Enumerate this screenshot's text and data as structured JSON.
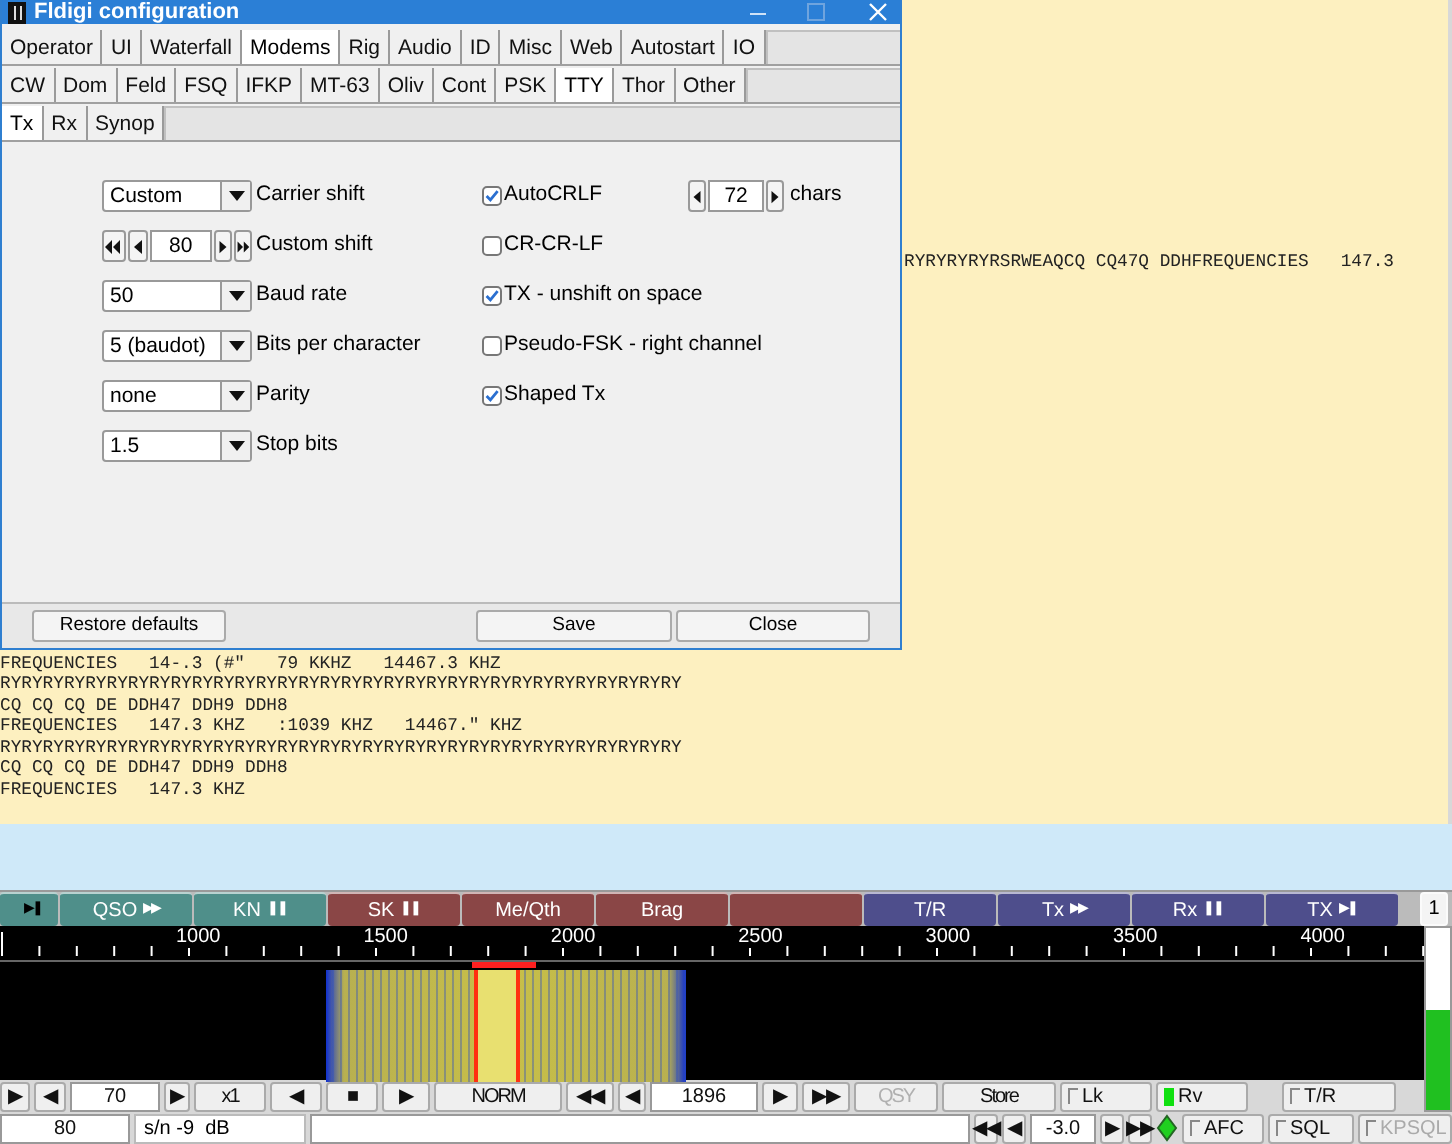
{
  "main": {
    "rx_side_line": "RYRYRYRYRSRWEAQCQ CQ47Q DDHFREQUENCIES   147.3",
    "rx_lines": [
      "FREQUENCIES   14-.3 (#\"   79 KKHZ   14467.3 KHZ",
      "RYRYRYRYRYRYRYRYRYRYRYRYRYRYRYRYRYRYRYRYRYRYRYRYRYRYRYRYRYRYRYRY",
      "CQ CQ CQ DE DDH47 DDH9 DDH8",
      "FREQUENCIES   147.3 KHZ   :1039 KHZ   14467.\" KHZ",
      "RYRYRYRYRYRYRYRYRYRYRYRYRYRYRYRYRYRYRYRYRYRYRYRYRYRYRYRYRYRYRYRY",
      "CQ CQ CQ DE DDH47 DDH9 DDH8",
      "FREQUENCIES   147.3 KHZ"
    ],
    "macros": [
      {
        "glyph": "▶❚",
        "color": "#4f8f8a"
      },
      {
        "label": "QSO",
        "glyph": "▶▶",
        "color": "#4f8f8a"
      },
      {
        "label": "KN",
        "glyph": "❚❚",
        "color": "#4f8f8a"
      },
      {
        "label": "SK",
        "glyph": "❚❚",
        "color": "#8a4646"
      },
      {
        "label": "Me/Qth",
        "color": "#8a4646"
      },
      {
        "label": "Brag",
        "color": "#8a4646"
      },
      {
        "color": "#8a4646"
      },
      {
        "label": "T/R",
        "color": "#4e4e8c"
      },
      {
        "label": "Tx",
        "glyph": "▶▶",
        "color": "#4e4e8c"
      },
      {
        "label": "Rx",
        "glyph": "❚❚",
        "color": "#4e4e8c"
      },
      {
        "label": "TX",
        "glyph": "▶❚",
        "color": "#4e4e8c"
      },
      {
        "label": "1",
        "color": "#f4f4f4"
      }
    ],
    "ruler": {
      "labels": [
        "1000",
        "1500",
        "2000",
        "2500",
        "3000",
        "3500",
        "4000"
      ]
    },
    "signal_level": {
      "level": 0.55
    },
    "controls": [
      {
        "kind": "button",
        "text": "▶"
      },
      {
        "kind": "button",
        "text": "◀"
      },
      {
        "kind": "field",
        "text": "70"
      },
      {
        "kind": "button",
        "text": "▶"
      },
      {
        "kind": "button",
        "text": "x1"
      },
      {
        "kind": "button",
        "text": "◀"
      },
      {
        "kind": "button",
        "text": "■"
      },
      {
        "kind": "button",
        "text": "▶"
      },
      {
        "kind": "button",
        "text": "NORM"
      },
      {
        "kind": "button",
        "text": "◀◀"
      },
      {
        "kind": "button",
        "text": "◀"
      },
      {
        "kind": "field",
        "text": "1896"
      },
      {
        "kind": "button",
        "text": "▶"
      },
      {
        "kind": "button",
        "text": "▶▶"
      },
      {
        "kind": "button",
        "text": "QSY",
        "disabled": true
      },
      {
        "kind": "button",
        "text": "Store"
      },
      {
        "kind": "check",
        "text": "Lk",
        "checked": false
      },
      {
        "kind": "light",
        "text": "Rv",
        "on": true
      },
      {
        "kind": "check",
        "text": "T/R",
        "checked": false
      }
    ],
    "status": [
      {
        "kind": "field",
        "text": "80"
      },
      {
        "kind": "label",
        "text": "s/n -9  dB"
      },
      {
        "kind": "field"
      },
      {
        "kind": "button",
        "text": "◀◀"
      },
      {
        "kind": "button",
        "text": "◀"
      },
      {
        "kind": "field",
        "text": "-3.0"
      },
      {
        "kind": "button",
        "text": "▶"
      },
      {
        "kind": "button",
        "text": "▶▶"
      },
      {
        "kind": "diamond",
        "on": true
      },
      {
        "kind": "check",
        "text": "AFC",
        "checked": false
      },
      {
        "kind": "check",
        "text": "SQL",
        "checked": false
      },
      {
        "kind": "check",
        "text": "KPSQL",
        "checked": false,
        "disabled": true
      }
    ]
  },
  "dialog": {
    "title": "Fldigi configuration",
    "tab_rows": [
      [
        {
          "label": "Operator",
          "selected": false
        },
        {
          "label": "UI",
          "selected": false
        },
        {
          "label": "Waterfall",
          "selected": false
        },
        {
          "label": "Modems",
          "selected": true
        },
        {
          "label": "Rig",
          "selected": false
        },
        {
          "label": "Audio",
          "selected": false
        },
        {
          "label": "ID",
          "selected": false
        },
        {
          "label": "Misc",
          "selected": false
        },
        {
          "label": "Web",
          "selected": false
        },
        {
          "label": "Autostart",
          "selected": false
        },
        {
          "label": "IO",
          "selected": false
        }
      ],
      [
        {
          "label": "CW",
          "selected": false
        },
        {
          "label": "Dom",
          "selected": false
        },
        {
          "label": "Feld",
          "selected": false
        },
        {
          "label": "FSQ",
          "selected": false
        },
        {
          "label": "IFKP",
          "selected": false
        },
        {
          "label": "MT-63",
          "selected": false
        },
        {
          "label": "Oliv",
          "selected": false
        },
        {
          "label": "Cont",
          "selected": false
        },
        {
          "label": "PSK",
          "selected": false
        },
        {
          "label": "TTY",
          "selected": true
        },
        {
          "label": "Thor",
          "selected": false
        },
        {
          "label": "Other",
          "selected": false
        }
      ],
      [
        {
          "label": "Tx",
          "selected": true
        },
        {
          "label": "Rx",
          "selected": false
        },
        {
          "label": "Synop",
          "selected": false
        }
      ]
    ],
    "left_settings": [
      {
        "kind": "dropdown",
        "value": "Custom",
        "label": "Carrier shift"
      },
      {
        "kind": "spinner",
        "value": "80",
        "label": "Custom shift"
      },
      {
        "kind": "dropdown",
        "value": "50",
        "label": "Baud rate"
      },
      {
        "kind": "dropdown",
        "value": "5 (baudot)",
        "label": "Bits per character"
      },
      {
        "kind": "dropdown",
        "value": "none",
        "label": "Parity"
      },
      {
        "kind": "dropdown",
        "value": "1.5",
        "label": "Stop bits"
      }
    ],
    "right_settings": [
      {
        "label": "AutoCRLF",
        "checked": true
      },
      {
        "label": "CR-CR-LF",
        "checked": false
      },
      {
        "label": "TX - unshift on space",
        "checked": true
      },
      {
        "label": "Pseudo-FSK - right channel",
        "checked": false
      },
      {
        "label": "Shaped Tx",
        "checked": true
      }
    ],
    "line_length": {
      "value": "72",
      "label": "chars"
    },
    "buttons": [
      "Restore defaults",
      "Save",
      "Close"
    ]
  }
}
